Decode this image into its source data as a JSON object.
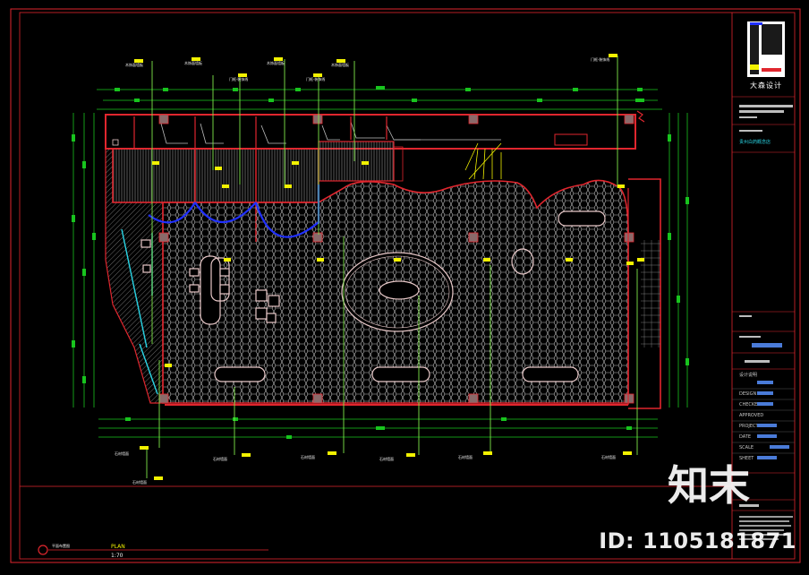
{
  "drawing": {
    "brand_name": "大森设计",
    "project_name": "贵州白药概念店",
    "plan_label": "PLAN",
    "scale": "1:70",
    "legend_text": "平面布置图"
  },
  "title_block": {
    "rows": [
      "设计说明",
      "DESIGN",
      "CHECKED",
      "APPROVED",
      "PROJECT NO.",
      "DATE",
      "SCALE",
      "SHEET"
    ]
  },
  "callouts": {
    "top": [
      "木饰面墙板",
      "木饰面墙板",
      "门框·装饰线",
      "木饰面墙板",
      "门框·装饰线",
      "木饰面墙板",
      "门框·装饰线"
    ],
    "bottom": [
      "石材墙面",
      "石材墙面",
      "石材墙面",
      "石材墙面",
      "石材墙面",
      "石材墙面",
      "石材墙面"
    ]
  },
  "watermark": {
    "logo": "知末",
    "id_text": "ID: 1105181871"
  },
  "colors": {
    "background": "#000000",
    "wall": "#e0262e",
    "dimension": "#18c41e",
    "callout_leader": "#7fe84a",
    "callout_tag": "#f2f200",
    "curtain": "#2030ff",
    "glass": "#2ad6e6",
    "furniture": "#e8c8c8",
    "column": "#8a6a6a",
    "hatch": "#bdbdbd"
  }
}
